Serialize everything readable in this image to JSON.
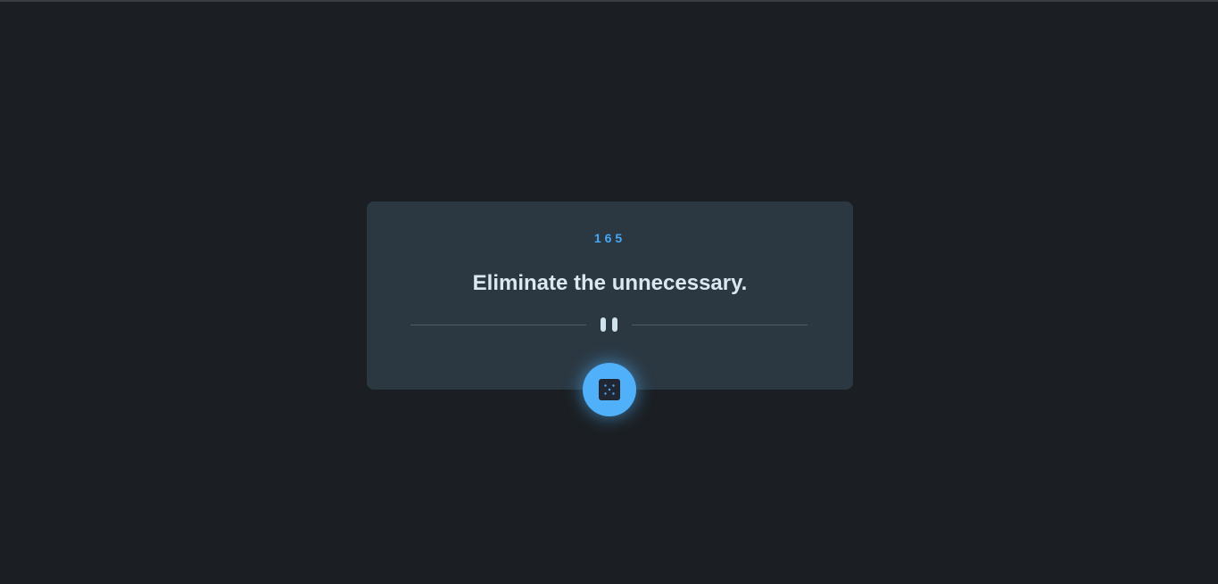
{
  "advice": {
    "id": "165",
    "text": "Eliminate the unnecessary."
  },
  "icons": {
    "divider": "pause-icon",
    "button": "dice-icon"
  },
  "colors": {
    "background": "#1b1f23",
    "card": "#2b3842",
    "accent": "#45a8f8",
    "button": "#50b0fa",
    "text": "#dbe8f0"
  }
}
